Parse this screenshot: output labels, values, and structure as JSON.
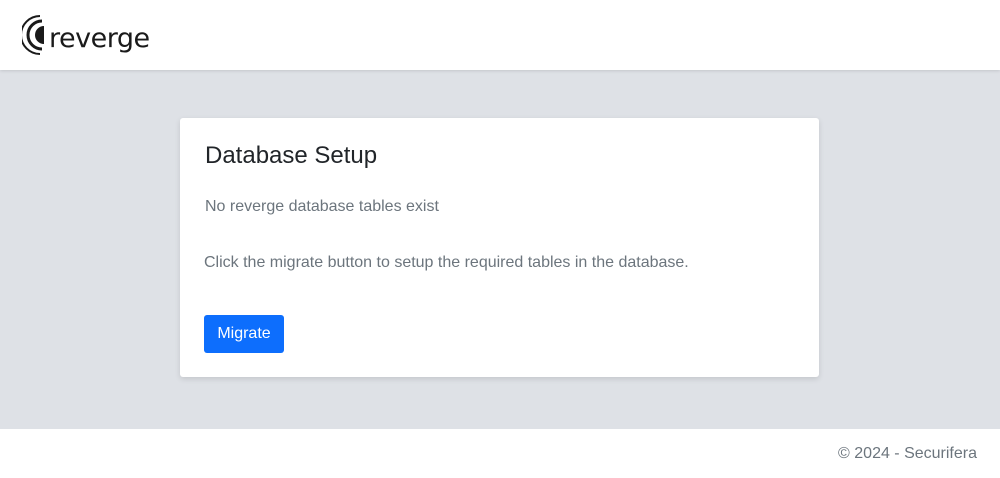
{
  "header": {
    "logo_text": "reverge"
  },
  "card": {
    "title": "Database Setup",
    "subtitle": "No reverge database tables exist",
    "instructions": "Click the migrate button to setup the required tables in the database.",
    "migrate_label": "Migrate"
  },
  "footer": {
    "copyright": "© 2024 - Securifera"
  },
  "colors": {
    "accent": "#0d6efd",
    "page_background": "#dee1e6",
    "muted_text": "#6c757d"
  }
}
